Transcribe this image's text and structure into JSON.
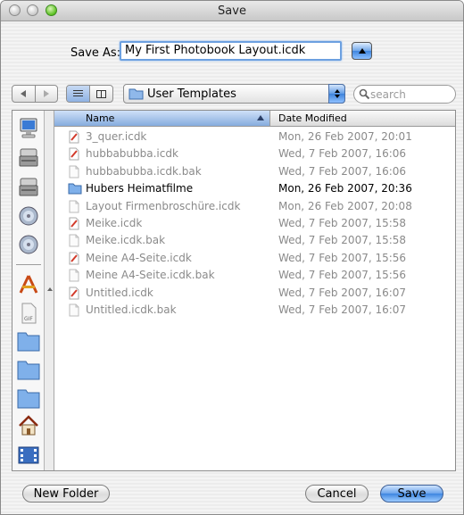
{
  "window": {
    "title": "Save"
  },
  "save_as": {
    "label": "Save As:",
    "value": "My First Photobook Layout.icdk"
  },
  "location_popup": {
    "label": "User Templates"
  },
  "search": {
    "placeholder": "search"
  },
  "columns": {
    "name": "Name",
    "date": "Date Modified"
  },
  "sidebar": {
    "items": [
      {
        "icon": "computer-icon"
      },
      {
        "icon": "hard-drive-icon"
      },
      {
        "icon": "hard-drive-icon"
      },
      {
        "icon": "network-disk-icon"
      },
      {
        "icon": "network-disk-icon"
      },
      {
        "icon": "applications-icon"
      },
      {
        "icon": "gif-document-icon"
      },
      {
        "icon": "folder-icon"
      },
      {
        "icon": "folder-icon"
      },
      {
        "icon": "folder-icon"
      },
      {
        "icon": "home-icon"
      },
      {
        "icon": "movies-icon"
      }
    ]
  },
  "files": [
    {
      "name": "3_quer.icdk",
      "date": "Mon, 26 Feb 2007, 20:01",
      "kind": "doc",
      "enabled": false
    },
    {
      "name": "hubbabubba.icdk",
      "date": "Wed, 7 Feb 2007, 16:06",
      "kind": "doc",
      "enabled": false
    },
    {
      "name": "hubbabubba.icdk.bak",
      "date": "Wed, 7 Feb 2007, 16:06",
      "kind": "bak",
      "enabled": false
    },
    {
      "name": "Hubers Heimatfilme",
      "date": "Mon, 26 Feb 2007, 20:36",
      "kind": "folder",
      "enabled": true
    },
    {
      "name": "Layout Firmenbroschüre.icdk",
      "date": "Mon, 26 Feb 2007, 20:08",
      "kind": "bak",
      "enabled": false
    },
    {
      "name": "Meike.icdk",
      "date": "Wed, 7 Feb 2007, 15:58",
      "kind": "doc",
      "enabled": false
    },
    {
      "name": "Meike.icdk.bak",
      "date": "Wed, 7 Feb 2007, 15:58",
      "kind": "bak",
      "enabled": false
    },
    {
      "name": "Meine A4-Seite.icdk",
      "date": "Wed, 7 Feb 2007, 15:56",
      "kind": "doc",
      "enabled": false
    },
    {
      "name": "Meine A4-Seite.icdk.bak",
      "date": "Wed, 7 Feb 2007, 15:56",
      "kind": "bak",
      "enabled": false
    },
    {
      "name": "Untitled.icdk",
      "date": "Wed, 7 Feb 2007, 16:07",
      "kind": "doc",
      "enabled": false
    },
    {
      "name": "Untitled.icdk.bak",
      "date": "Wed, 7 Feb 2007, 16:07",
      "kind": "bak",
      "enabled": false
    }
  ],
  "buttons": {
    "new_folder": "New Folder",
    "cancel": "Cancel",
    "save": "Save"
  }
}
